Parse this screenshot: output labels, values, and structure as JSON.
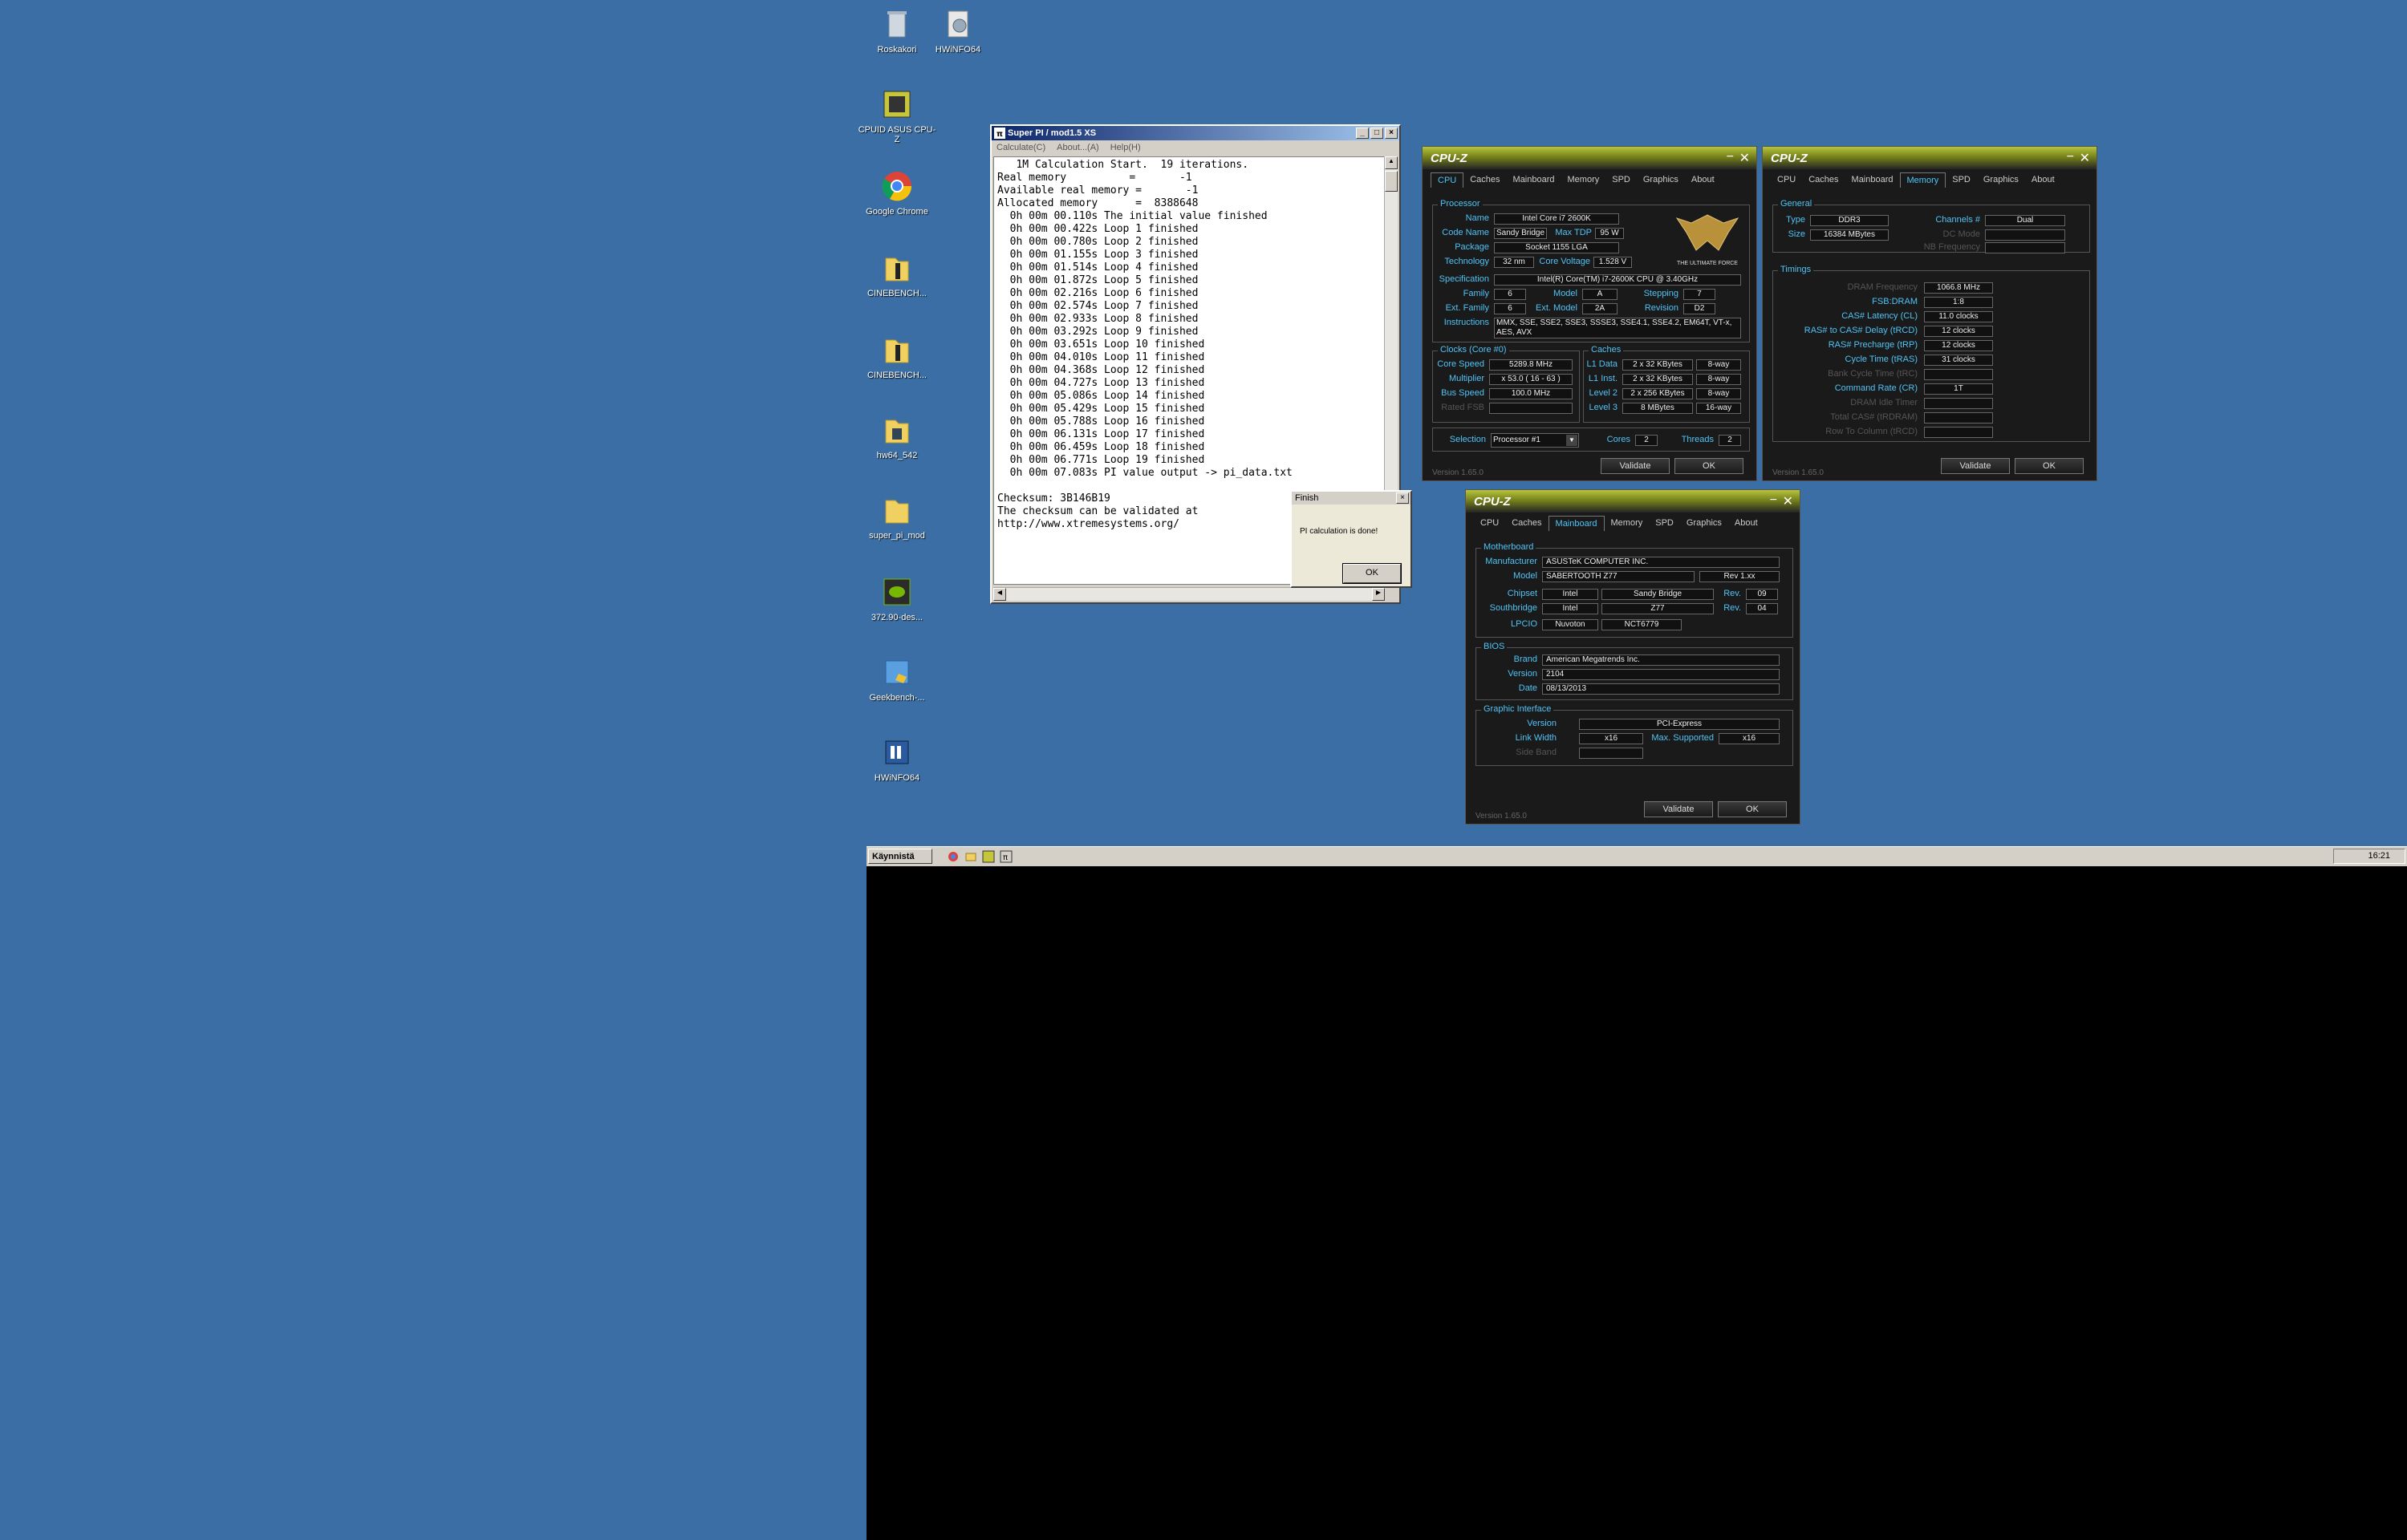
{
  "desktop": {
    "icons": [
      {
        "label": "Roskakori"
      },
      {
        "label": "HWiNFO64"
      },
      {
        "label": "CPUID ASUS CPU-Z"
      },
      {
        "label": "Google Chrome"
      },
      {
        "label": "CINEBENCH..."
      },
      {
        "label": "CINEBENCH..."
      },
      {
        "label": "hw64_542"
      },
      {
        "label": "super_pi_mod"
      },
      {
        "label": "372.90-des..."
      },
      {
        "label": "Geekbench-..."
      },
      {
        "label": "HWiNFO64"
      }
    ]
  },
  "taskbar": {
    "start_label": "Käynnistä",
    "clock": "16:21"
  },
  "superpi": {
    "title": "Super PI / mod1.5 XS",
    "menu": [
      "Calculate(C)",
      "About...(A)",
      "Help(H)"
    ],
    "lines": [
      "   1M Calculation Start.  19 iterations.",
      "Real memory          =       -1",
      "Available real memory =       -1",
      "Allocated memory      =  8388648",
      "  0h 00m 00.110s The initial value finished",
      "  0h 00m 00.422s Loop 1 finished",
      "  0h 00m 00.780s Loop 2 finished",
      "  0h 00m 01.155s Loop 3 finished",
      "  0h 00m 01.514s Loop 4 finished",
      "  0h 00m 01.872s Loop 5 finished",
      "  0h 00m 02.216s Loop 6 finished",
      "  0h 00m 02.574s Loop 7 finished",
      "  0h 00m 02.933s Loop 8 finished",
      "  0h 00m 03.292s Loop 9 finished",
      "  0h 00m 03.651s Loop 10 finished",
      "  0h 00m 04.010s Loop 11 finished",
      "  0h 00m 04.368s Loop 12 finished",
      "  0h 00m 04.727s Loop 13 finished",
      "  0h 00m 05.086s Loop 14 finished",
      "  0h 00m 05.429s Loop 15 finished",
      "  0h 00m 05.788s Loop 16 finished",
      "  0h 00m 06.131s Loop 17 finished",
      "  0h 00m 06.459s Loop 18 finished",
      "  0h 00m 06.771s Loop 19 finished",
      "  0h 00m 07.083s PI value output -> pi_data.txt",
      "",
      "Checksum: 3B146B19",
      "The checksum can be validated at",
      "http://www.xtremesystems.org/"
    ],
    "dialog": {
      "title": "Finish",
      "message": "PI calculation is done!",
      "ok": "OK"
    }
  },
  "cpuz_tabs": [
    "CPU",
    "Caches",
    "Mainboard",
    "Memory",
    "SPD",
    "Graphics",
    "About"
  ],
  "cpuz_common": {
    "title": "CPU-Z",
    "version": "Version 1.65.0",
    "validate": "Validate",
    "ok": "OK"
  },
  "cpuz_cpu": {
    "processor_group": "Processor",
    "name_label": "Name",
    "name": "Intel Core i7 2600K",
    "codename_label": "Code Name",
    "codename": "Sandy Bridge",
    "maxtdp_label": "Max TDP",
    "maxtdp": "95 W",
    "package_label": "Package",
    "package": "Socket 1155 LGA",
    "technology_label": "Technology",
    "technology": "32 nm",
    "corevoltage_label": "Core Voltage",
    "corevoltage": "1.528 V",
    "spec_label": "Specification",
    "spec": "Intel(R) Core(TM) i7-2600K CPU @ 3.40GHz",
    "family_label": "Family",
    "family": "6",
    "model_label": "Model",
    "model": "A",
    "stepping_label": "Stepping",
    "stepping": "7",
    "extfamily_label": "Ext. Family",
    "extfamily": "6",
    "extmodel_label": "Ext. Model",
    "extmodel": "2A",
    "revision_label": "Revision",
    "revision": "D2",
    "instructions_label": "Instructions",
    "instructions": "MMX, SSE, SSE2, SSE3, SSSE3, SSE4.1, SSE4.2, EM64T, VT-x, AES, AVX",
    "clocks_group": "Clocks (Core #0)",
    "corespeed_label": "Core Speed",
    "corespeed": "5289.8 MHz",
    "multiplier_label": "Multiplier",
    "multiplier": "x 53.0 ( 16 - 63 )",
    "busspeed_label": "Bus Speed",
    "busspeed": "100.0 MHz",
    "ratedfsb_label": "Rated FSB",
    "caches_group": "Caches",
    "l1d_label": "L1 Data",
    "l1d": "2 x 32 KBytes",
    "l1d_way": "8-way",
    "l1i_label": "L1 Inst.",
    "l1i": "2 x 32 KBytes",
    "l1i_way": "8-way",
    "l2_label": "Level 2",
    "l2": "2 x 256 KBytes",
    "l2_way": "8-way",
    "l3_label": "Level 3",
    "l3": "8 MBytes",
    "l3_way": "16-way",
    "selection_label": "Selection",
    "selection": "Processor #1",
    "cores_label": "Cores",
    "cores": "2",
    "threads_label": "Threads",
    "threads": "2",
    "logo_text": "THE ULTIMATE FORCE"
  },
  "cpuz_mem": {
    "general_group": "General",
    "type_label": "Type",
    "type": "DDR3",
    "channels_label": "Channels #",
    "channels": "Dual",
    "size_label": "Size",
    "size": "16384 MBytes",
    "dcmode_label": "DC Mode",
    "nbfreq_label": "NB Frequency",
    "timings_group": "Timings",
    "dram_label": "DRAM Frequency",
    "dram": "1066.8 MHz",
    "fsb_label": "FSB:DRAM",
    "fsb": "1:8",
    "cl_label": "CAS# Latency (CL)",
    "cl": "11.0 clocks",
    "trcd_label": "RAS# to CAS# Delay (tRCD)",
    "trcd": "12 clocks",
    "trp_label": "RAS# Precharge (tRP)",
    "trp": "12 clocks",
    "tras_label": "Cycle Time (tRAS)",
    "tras": "31 clocks",
    "trc_label": "Bank Cycle Time (tRC)",
    "cr_label": "Command Rate (CR)",
    "cr": "1T",
    "idle_label": "DRAM Idle Timer",
    "totalcas_label": "Total CAS# (tRDRAM)",
    "rowcol_label": "Row To Column (tRCD)"
  },
  "cpuz_mb": {
    "mb_group": "Motherboard",
    "manufacturer_label": "Manufacturer",
    "manufacturer": "ASUSTeK COMPUTER INC.",
    "model_label": "Model",
    "model": "SABERTOOTH Z77",
    "model_rev": "Rev 1.xx",
    "chipset_label": "Chipset",
    "chipset_vendor": "Intel",
    "chipset": "Sandy Bridge",
    "rev_label": "Rev.",
    "chipset_rev": "09",
    "south_label": "Southbridge",
    "south_vendor": "Intel",
    "south": "Z77",
    "south_rev": "04",
    "lpcio_label": "LPCIO",
    "lpcio_vendor": "Nuvoton",
    "lpcio": "NCT6779",
    "bios_group": "BIOS",
    "brand_label": "Brand",
    "brand": "American Megatrends Inc.",
    "version_label": "Version",
    "version": "2104",
    "date_label": "Date",
    "date": "08/13/2013",
    "gi_group": "Graphic Interface",
    "gi_version_label": "Version",
    "gi_version": "PCI-Express",
    "linkwidth_label": "Link Width",
    "linkwidth": "x16",
    "maxsup_label": "Max. Supported",
    "maxsup": "x16",
    "sideband_label": "Side Band"
  }
}
